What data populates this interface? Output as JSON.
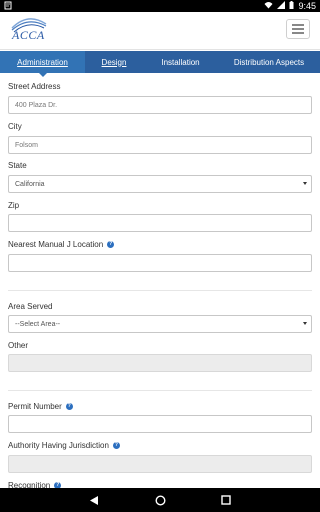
{
  "status_bar": {
    "time": "9:45",
    "icons": [
      "notification-icon",
      "wifi-icon",
      "signal-icon",
      "battery-icon"
    ]
  },
  "app": {
    "logo_text": "ACCA"
  },
  "tabs": [
    {
      "label": "Administration",
      "active": true
    },
    {
      "label": "Design",
      "active": false
    },
    {
      "label": "Installation",
      "active": false
    },
    {
      "label": "Distribution Aspects",
      "active": false
    }
  ],
  "form": {
    "street_address": {
      "label": "Street Address",
      "value": "400 Plaza Dr."
    },
    "city": {
      "label": "City",
      "value": "Folsom"
    },
    "state": {
      "label": "State",
      "value": "California"
    },
    "zip": {
      "label": "Zip",
      "value": ""
    },
    "manual_j": {
      "label": "Nearest Manual J Location",
      "value": ""
    },
    "area_served": {
      "label": "Area Served",
      "value": "--Select Area--"
    },
    "other": {
      "label": "Other",
      "value": ""
    },
    "permit_number": {
      "label": "Permit Number",
      "value": ""
    },
    "authority": {
      "label": "Authority Having Jurisdiction",
      "value": ""
    },
    "recognition": {
      "label": "Recognition"
    }
  },
  "colors": {
    "tab_bar": "#2c5f9e",
    "tab_active": "#3273b5",
    "help_icon": "#2c6fbf",
    "logo": "#2a5aa6"
  },
  "nav": {
    "icons": [
      "back-icon",
      "home-icon",
      "recents-icon"
    ]
  }
}
